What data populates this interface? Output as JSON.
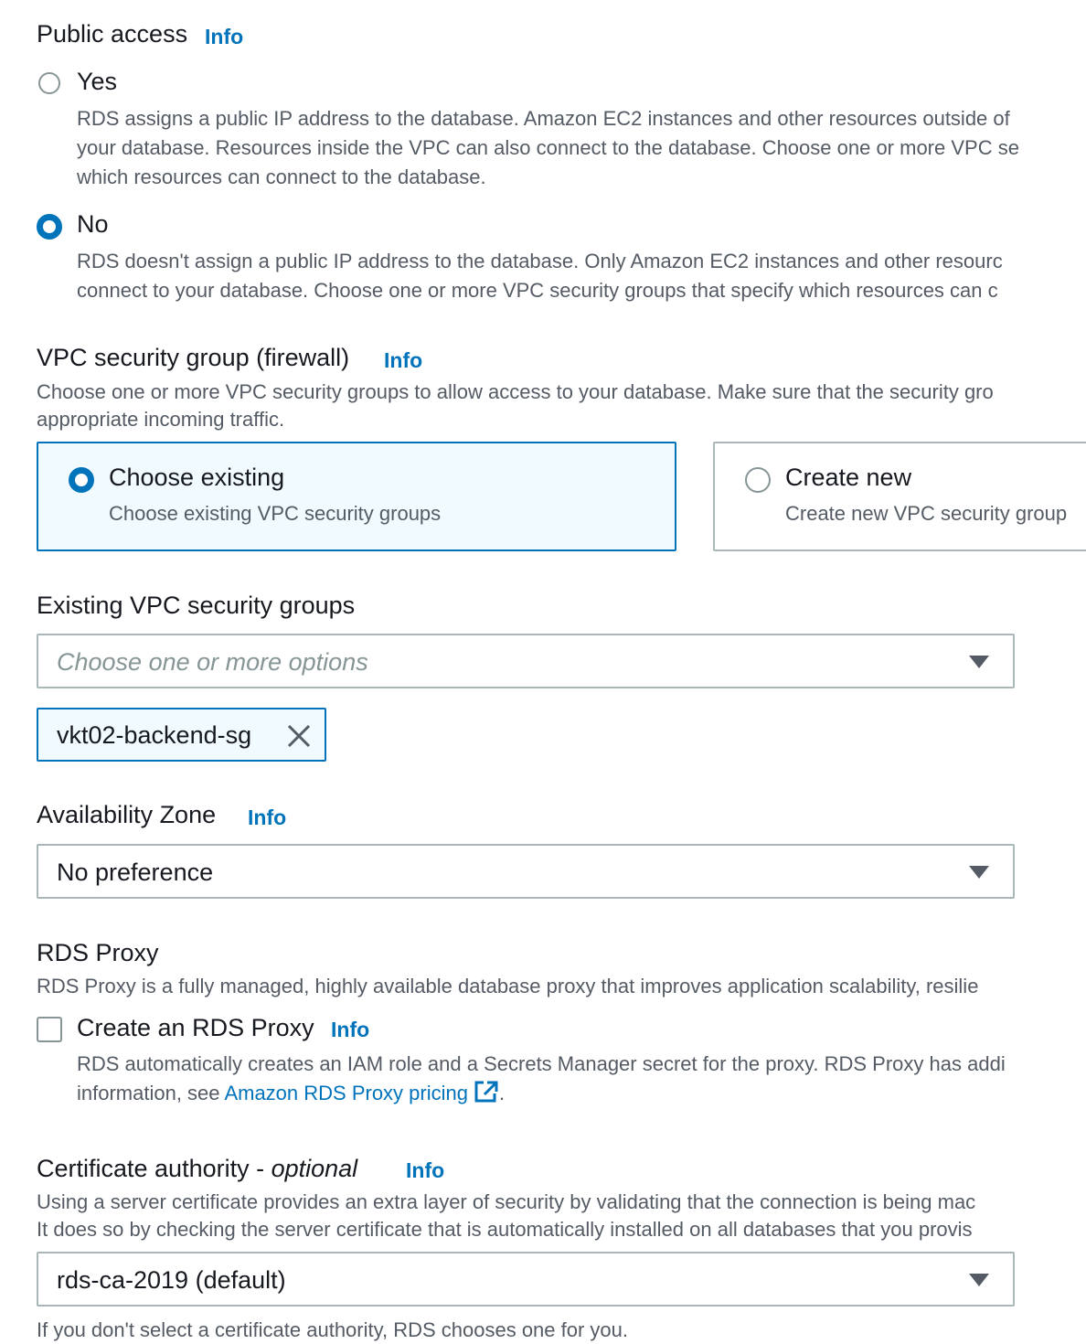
{
  "public_access": {
    "heading": "Public access",
    "info": "Info",
    "yes": {
      "label": "Yes",
      "desc_lines": [
        "RDS assigns a public IP address to the database. Amazon EC2 instances and other resources outside of",
        "your database. Resources inside the VPC can also connect to the database. Choose one or more VPC se",
        "which resources can connect to the database."
      ],
      "checked": false
    },
    "no": {
      "label": "No",
      "desc_lines": [
        "RDS doesn't assign a public IP address to the database. Only Amazon EC2 instances and other resourc",
        "connect to your database. Choose one or more VPC security groups that specify which resources can c"
      ],
      "checked": true
    }
  },
  "vpc_security_group": {
    "heading": "VPC security group (firewall)",
    "info": "Info",
    "desc_lines": [
      "Choose one or more VPC security groups to allow access to your database. Make sure that the security gro",
      "appropriate incoming traffic."
    ],
    "choose_existing": {
      "label": "Choose existing",
      "desc": "Choose existing VPC security groups",
      "selected": true
    },
    "create_new": {
      "label": "Create new",
      "desc": "Create new VPC security group",
      "selected": false
    }
  },
  "existing_groups": {
    "label": "Existing VPC security groups",
    "placeholder": "Choose one or more options",
    "tokens": [
      "vkt02-backend-sg"
    ]
  },
  "availability_zone": {
    "label": "Availability Zone",
    "info": "Info",
    "value": "No preference"
  },
  "rds_proxy": {
    "heading": "RDS Proxy",
    "desc": "RDS Proxy is a fully managed, highly available database proxy that improves application scalability, resilie",
    "checkbox_label": "Create an RDS Proxy",
    "info": "Info",
    "checked": false,
    "detail_line1": "RDS automatically creates an IAM role and a Secrets Manager secret for the proxy. RDS Proxy has addi",
    "detail_line2_prefix": "information, see ",
    "pricing_link": "Amazon RDS Proxy pricing",
    "detail_line2_suffix": "."
  },
  "certificate_authority": {
    "label": "Certificate authority - ",
    "label_optional": "optional",
    "info": "Info",
    "desc_lines": [
      "Using a server certificate provides an extra layer of security by validating that the connection is being mac",
      "It does so by checking the server certificate that is automatically installed on all databases that you provis"
    ],
    "value": "rds-ca-2019 (default)",
    "hint": "If you don't select a certificate authority, RDS chooses one for you."
  },
  "colors": {
    "link": "#0073bb",
    "selected_bg": "#f1faff",
    "border": "#aab7b8",
    "secondary_text": "#545b64"
  }
}
